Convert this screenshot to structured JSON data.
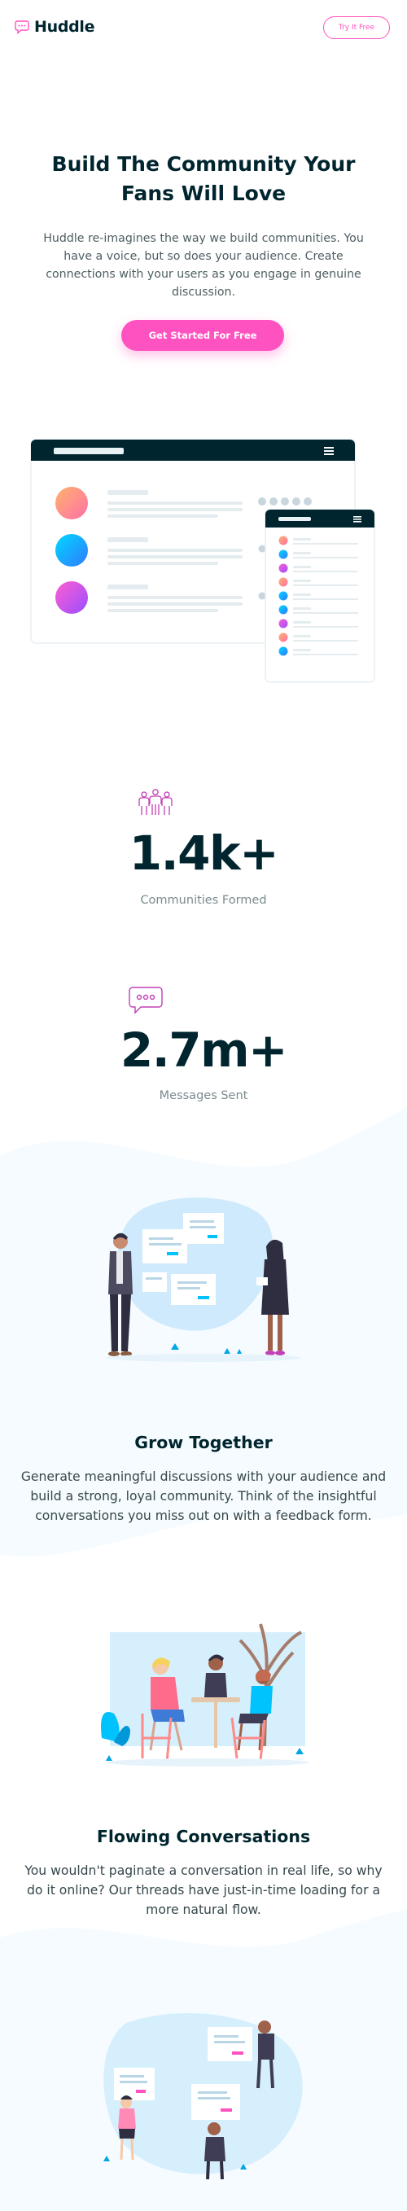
{
  "header": {
    "logo_text": "Huddle",
    "try_button": "Try It Free"
  },
  "hero": {
    "title": "Build The Community Your Fans Will Love",
    "description": "Huddle re-imagines the way we build communities. You have a voice, but so does your audience. Create connections with your users as you engage in genuine discussion.",
    "cta": "Get Started For Free"
  },
  "stats": [
    {
      "value": "1.4k+",
      "label": "Communities Formed",
      "icon": "communities-icon"
    },
    {
      "value": "2.7m+",
      "label": "Messages Sent",
      "icon": "messages-icon"
    }
  ],
  "features": [
    {
      "title": "Grow Together",
      "description": "Generate meaningful discussions with your audience and build a strong, loyal community. Think of the insightful conversations you miss out on with a feedback form."
    },
    {
      "title": "Flowing Conversations",
      "description": "You wouldn't paginate a conversation in real life, so why do it online? Our threads have just-in-time loading for a more natural flow."
    }
  ],
  "colors": {
    "brand_pink": "#ff52c1",
    "dark_navy": "#00252e",
    "section_tint": "#f5fbff",
    "cyan": "#00c2fd"
  }
}
